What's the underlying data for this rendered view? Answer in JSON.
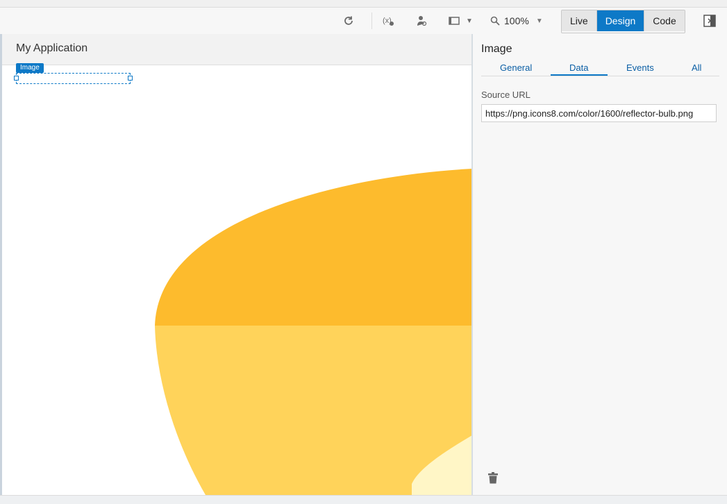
{
  "toolbar": {
    "icons": [
      "refresh-icon",
      "variables-icon",
      "user-settings-icon",
      "device-frame-icon"
    ],
    "zoom_value": "100%",
    "modes": [
      "Live",
      "Design",
      "Code"
    ],
    "active_mode": "Design"
  },
  "canvas": {
    "app_title": "My Application",
    "selected_component_tag": "Image",
    "colors": {
      "bulb_top": "#FDBB2D",
      "bulb_bottom": "#FFD35A",
      "bulb_light": "#FFF6C6"
    }
  },
  "properties": {
    "title": "Image",
    "tabs": [
      "General",
      "Data",
      "Events",
      "All"
    ],
    "active_tab": "Data",
    "source_url_label": "Source URL",
    "source_url_value": "https://png.icons8.com/color/1600/reflector-bulb.png"
  },
  "colors": {
    "accent": "#0D79C7"
  }
}
